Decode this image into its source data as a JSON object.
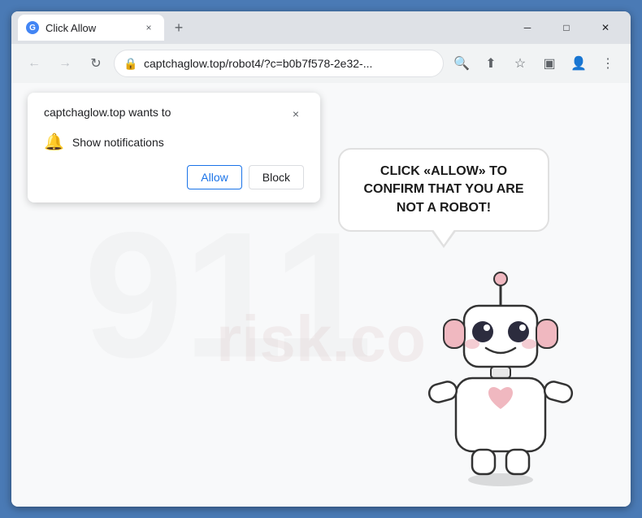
{
  "browser": {
    "tab": {
      "favicon": "G",
      "title": "Click Allow",
      "close_label": "×"
    },
    "new_tab_label": "+",
    "window_controls": {
      "minimize": "─",
      "maximize": "□",
      "close": "✕"
    },
    "toolbar": {
      "back": "←",
      "forward": "→",
      "refresh": "↻",
      "url": "captchaglow.top/robot4/?c=b0b7f578-2e32-...",
      "lock_icon": "🔒",
      "search_icon": "🔍",
      "share_icon": "⬆",
      "bookmark_icon": "☆",
      "split_icon": "▣",
      "profile_icon": "👤",
      "menu_icon": "⋮"
    }
  },
  "popup": {
    "title": "captchaglow.top wants to",
    "close_label": "×",
    "notification_label": "Show notifications",
    "bell_icon": "🔔",
    "allow_button": "Allow",
    "block_button": "Block"
  },
  "page": {
    "bubble_text": "CLICK «ALLOW» TO CONFIRM THAT YOU ARE NOT A ROBOT!",
    "watermark": "risk.co"
  }
}
